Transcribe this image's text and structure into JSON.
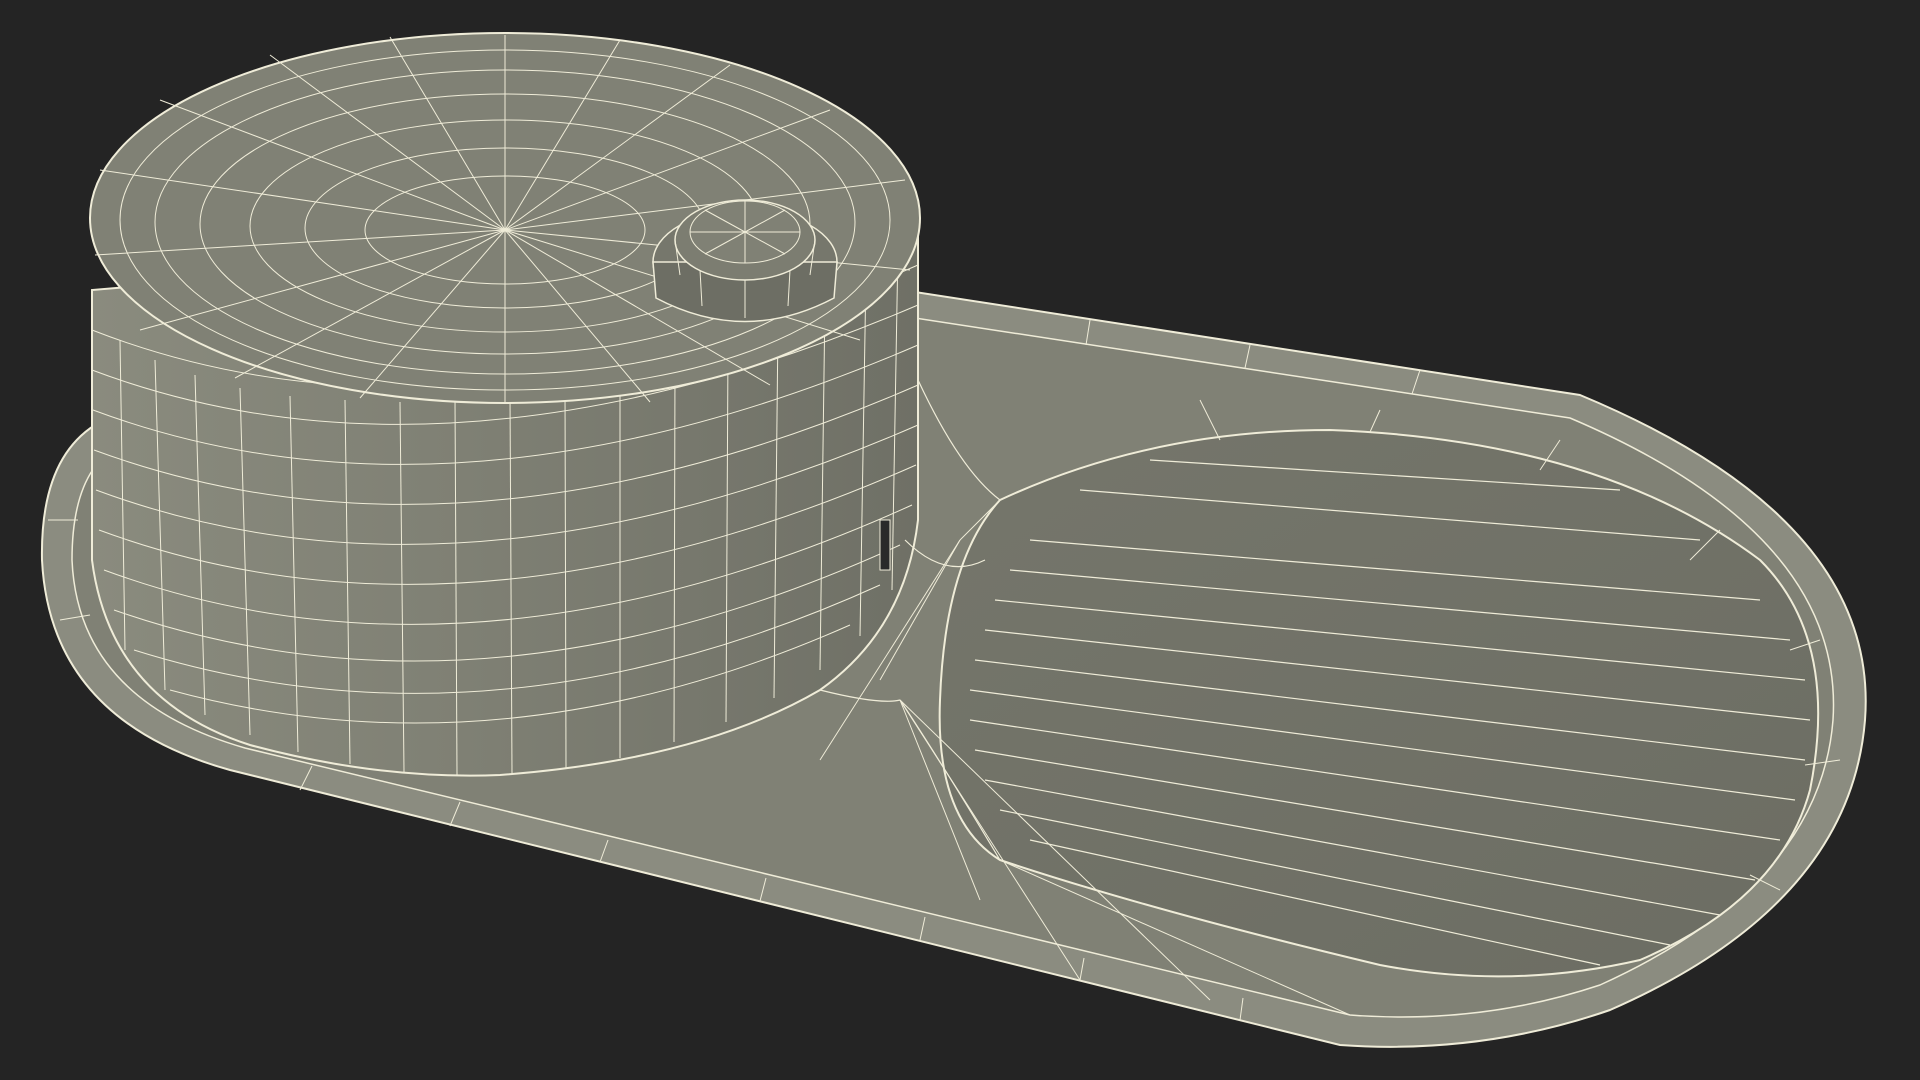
{
  "scene": {
    "subject": "sink-wireframe",
    "background_color": "#242424",
    "surface_color": "#7b7c70",
    "surface_shadow_color": "#65665c",
    "rim_color": "#8b8c80",
    "wire_color": "#efecd8"
  }
}
